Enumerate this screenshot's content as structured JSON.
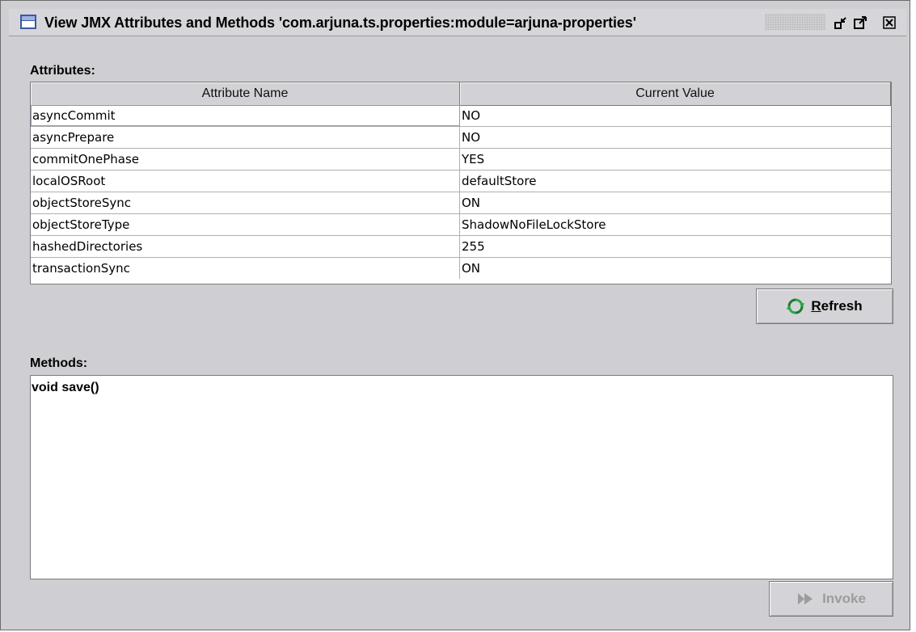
{
  "window": {
    "title": "View JMX Attributes and Methods 'com.arjuna.ts.properties:module=arjuna-properties'"
  },
  "attributes": {
    "section_label": "Attributes:",
    "columns": [
      "Attribute Name",
      "Current Value"
    ],
    "rows": [
      {
        "name": "asyncCommit",
        "value": "NO"
      },
      {
        "name": "asyncPrepare",
        "value": "NO"
      },
      {
        "name": "commitOnePhase",
        "value": "YES"
      },
      {
        "name": "localOSRoot",
        "value": "defaultStore"
      },
      {
        "name": "objectStoreSync",
        "value": "ON"
      },
      {
        "name": "objectStoreType",
        "value": "ShadowNoFileLockStore"
      },
      {
        "name": "hashedDirectories",
        "value": "255"
      },
      {
        "name": "transactionSync",
        "value": "ON"
      }
    ],
    "refresh_button": {
      "mnemonic": "R",
      "rest": "efresh",
      "icon": "refresh-icon"
    }
  },
  "methods": {
    "section_label": "Methods:",
    "items": [
      "void save()"
    ],
    "invoke_button": {
      "label": "Invoke",
      "icon": "invoke-arrow-icon",
      "enabled": false
    }
  },
  "colors": {
    "window_bg": "#cfcfd3",
    "refresh_icon_green": "#27a844",
    "disabled_text": "#9c9c9c"
  }
}
